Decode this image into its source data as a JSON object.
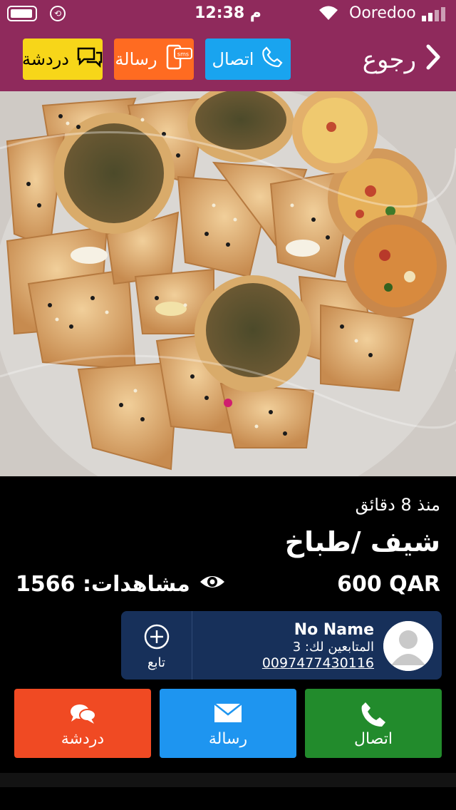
{
  "status": {
    "time": "12:38 م",
    "carrier": "Ooredoo"
  },
  "nav": {
    "back_label": "رجوع",
    "call_label": "اتصال",
    "message_label": "رسالة",
    "message_icon_text": "sms",
    "chat_label": "دردشة",
    "colors": {
      "bar": "#8f2a5c",
      "call": "#19a4ef",
      "message": "#ff6b21",
      "chat": "#f7d619"
    }
  },
  "listing": {
    "time_ago": "منذ 8 دقائق",
    "title": "شيف /طباخ",
    "price": "600 QAR",
    "views": "مشاهدات: 1566"
  },
  "seller": {
    "name": "No Name",
    "followers": "المتابعين لك: 3",
    "phone": "0097477430116",
    "follow_label": "تابع"
  },
  "actions": {
    "call_label": "اتصال",
    "message_label": "رسالة",
    "chat_label": "دردشة",
    "colors": {
      "call": "#228b2c",
      "message": "#1e95f0",
      "chat": "#f04a23"
    }
  },
  "icons": [
    "battery-icon",
    "orientation-lock-icon",
    "wifi-icon",
    "signal-icon",
    "chevron-right-icon",
    "phone-icon",
    "sms-phone-icon",
    "chat-bubbles-icon",
    "eye-icon",
    "plus-circle-icon",
    "avatar-icon",
    "envelope-icon"
  ]
}
